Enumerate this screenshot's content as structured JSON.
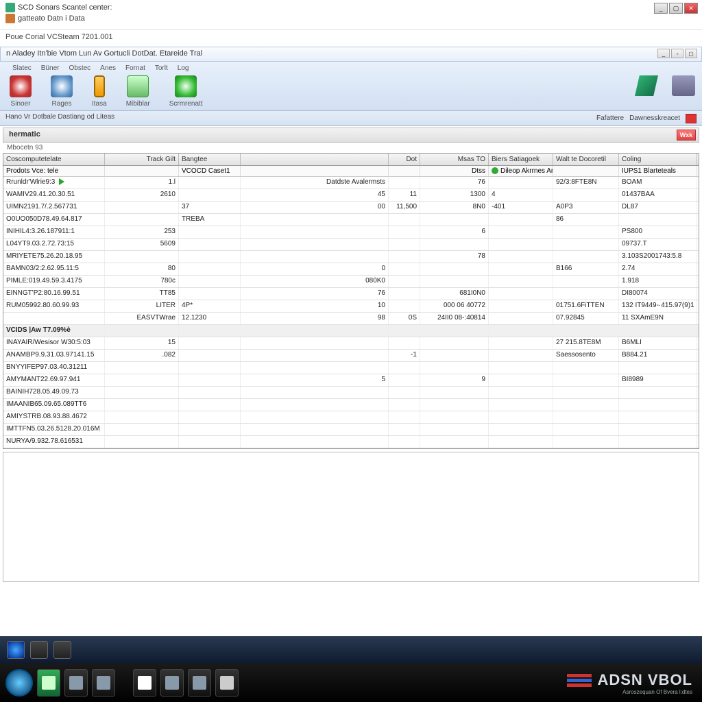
{
  "header": {
    "title1": "SCD Sonars Scantel center:",
    "title2": "gatteato Datn i Data",
    "subtitle": "Poue Corial VCSteam 7201.001"
  },
  "menubar": {
    "text": "n Aladey Itn'bie Vtom Lun Av Gortucli DotDat. Etareide Tral"
  },
  "ribbon": {
    "tabs": [
      "Slatec",
      "Büner",
      "Obstec",
      "Anes",
      "Fornat",
      "Torlt",
      "Log"
    ],
    "items": [
      {
        "icon": "r1",
        "label": "Sinoer"
      },
      {
        "icon": "r2",
        "label": "Rages"
      },
      {
        "icon": "r3",
        "label": "Itasa"
      },
      {
        "icon": "r4",
        "label": "Mibiblar"
      },
      {
        "icon": "r5",
        "label": "Scrmrenatt"
      }
    ]
  },
  "infobar": {
    "left": "Hano Vr Dotbale Dastiang od Liteas",
    "right": [
      "Fafattere",
      "Dawnesskreacet"
    ]
  },
  "panel": {
    "title": "hermatic",
    "sub": "Mbocetn   93",
    "close": "Wxk"
  },
  "columns": [
    "Coscomputetelate",
    "Track",
    "Gilt",
    "Bangtee",
    "Dot",
    "Msas",
    "TO",
    "Biers Satiagoek",
    "Walt te Docoretil",
    "Coling"
  ],
  "filter": {
    "c0": "Prodots  Vce: tele",
    "c2": "",
    "c3": "VCOCD Caset1",
    "c5": "Dtss",
    "c6": "",
    "c7_icon": true,
    "c7": "Dileop Akrrnes  Artirler",
    "c8": "IUPS1",
    "c8b": "Blarteteals"
  },
  "rows1": [
    {
      "c0": "Rrunldr'Wlrie9:3",
      "play": true,
      "c1": "1.l",
      "c2": "",
      "c3": "Datdste Avalermsts",
      "c4": "",
      "c5": "76",
      "c6": "",
      "c7": "92/3:8FTE8N",
      "c8": "BOAM"
    },
    {
      "c0": "WAMIV29.41.20.30.51",
      "c1": "2610",
      "c3": "45",
      "c4": "11",
      "c5": "1300",
      "c6": "4",
      "c7": "",
      "c8": "01437BAA"
    },
    {
      "c0": "UIMN2191.7/.2.567731",
      "c1": "",
      "c2": "37",
      "c3": "00",
      "c4": "11,500",
      "c5": "8N0",
      "c6": "-401",
      "c7": "A0P3",
      "c8": "DL87"
    },
    {
      "c0": "O0UO050D78.49.64.817",
      "c1": "",
      "c2": "TREBA",
      "c7": "86"
    },
    {
      "c0": "INIHIL4:3.26.187911:1",
      "c1": "253",
      "c5": "6",
      "c8": "PS800"
    },
    {
      "c0": "L04YT9.03.2.72.73:15",
      "c1": "5609",
      "c8": "09737.T"
    },
    {
      "c0": "MRIYETE75.26.20.18.95",
      "c5": "78",
      "c8": "3.103S2001743:5.8"
    },
    {
      "c0": "BAMN03/2:2.62.95.11:5",
      "c1": "80",
      "c3": "0",
      "c7": "B166",
      "c8": "2.74"
    },
    {
      "c0": "PIMLE:019.49.59.3.4175",
      "c1": "780c",
      "c2": "",
      "c3": "080K0",
      "c8": "1.918"
    },
    {
      "c0": "EINNGT'P2:80.16.99.51",
      "c1": "TT85",
      "c3": "76",
      "c5": "681I0N0",
      "c8": "DI80074"
    },
    {
      "c0": "RUM05992.80.60.99.93",
      "c1": "LITER",
      "c2": "4P*",
      "c3": "10",
      "c5": "000 06 40772",
      "c7": "01751.6FiTTEN",
      "c8": "132",
      "c8b": "IT9449-·415.97(9)1"
    },
    {
      "c0": "",
      "c1": "EASVTWrae",
      "c2": "12.1230",
      "c3": "98",
      "c4": "0S",
      "c5": "24II0 08-:40814",
      "c7": "07.92845",
      "c8": "11",
      "c8b": "SXAmE9N"
    }
  ],
  "section2": "VCIDS |Aw T7.09%è",
  "rows2": [
    {
      "c0": "INAYAIR/Wesisor W30:5:03",
      "c1": "15",
      "c7": "27 215.8TE8M",
      "c8": "B6MLI"
    },
    {
      "c0": "ANAMBP9.9.31.03.97141.15",
      "c1": ".082",
      "c4": "-1",
      "c7": "Saessosento",
      "c8": "B884.21"
    },
    {
      "c0": "BNYYIFEP97.03.40.31211"
    },
    {
      "c0": "AMYMANT22.69.97.941",
      "c3": "5",
      "c5": "9",
      "c8": "BI8989"
    },
    {
      "c0": "BAINIH728.05.49.09.73"
    },
    {
      "c0": "IMAANIB65.09.65.089TT6"
    },
    {
      "c0": "AMIYSTRB.08.93.88.4672"
    },
    {
      "c0": "IMTTFN5.03.26.5128.20.016M"
    },
    {
      "c0": "NURYA/9.932.78.616531"
    }
  ],
  "brand": {
    "name": "ADSN VBOL",
    "sub": "Asroszequan Of Bvera l:dtes"
  }
}
